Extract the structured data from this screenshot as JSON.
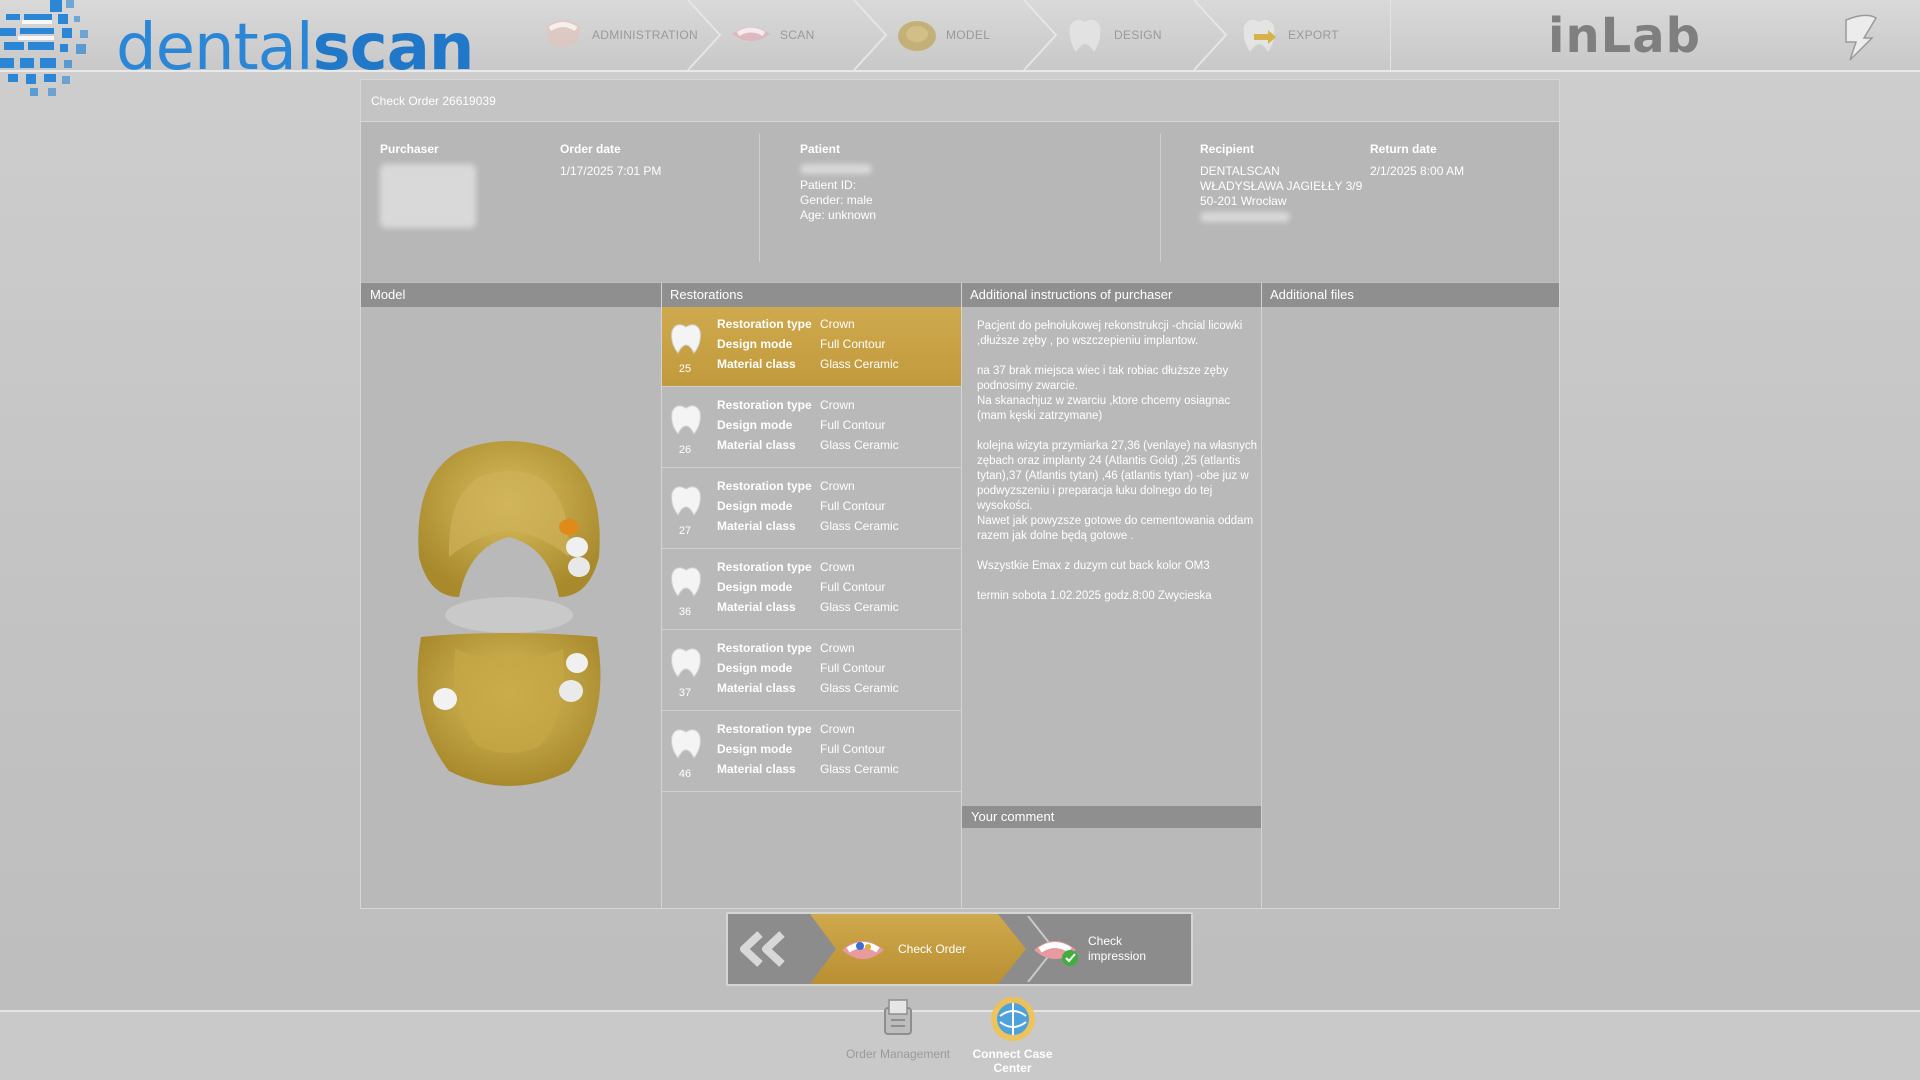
{
  "app": {
    "logo_prefix": "dental",
    "logo_suffix": "scan",
    "brand_right": "inLab"
  },
  "workflow": {
    "steps": [
      {
        "label": "ADMINISTRATION",
        "icon": "jaw-icon"
      },
      {
        "label": "SCAN",
        "icon": "scan-jaw-icon"
      },
      {
        "label": "MODEL",
        "icon": "model-icon"
      },
      {
        "label": "DESIGN",
        "icon": "design-tooth-icon"
      },
      {
        "label": "EXPORT",
        "icon": "export-tooth-icon"
      }
    ]
  },
  "order": {
    "title": "Check Order 26619039",
    "purchaser_label": "Purchaser",
    "order_date_label": "Order date",
    "order_date": "1/17/2025 7:01 PM",
    "patient_label": "Patient",
    "patient_id": "Patient ID:",
    "patient_gender": "Gender: male",
    "patient_age": "Age: unknown",
    "recipient_label": "Recipient",
    "recipient_line1": "DENTALSCAN",
    "recipient_line2": "WŁADYSŁAWA JAGIEŁŁY 3/9",
    "recipient_line3": "50-201 Wrocław",
    "return_date_label": "Return date",
    "return_date": "2/1/2025 8:00 AM"
  },
  "columns": {
    "model": "Model",
    "restorations": "Restorations",
    "instructions": "Additional instructions of purchaser",
    "files": "Additional files",
    "comment": "Your comment"
  },
  "restoration_keys": {
    "type": "Restoration type",
    "mode": "Design mode",
    "material": "Material class"
  },
  "restorations": [
    {
      "tooth": "25",
      "type": "Crown",
      "mode": "Full Contour",
      "material": "Glass Ceramic",
      "selected": true
    },
    {
      "tooth": "26",
      "type": "Crown",
      "mode": "Full Contour",
      "material": "Glass Ceramic",
      "selected": false
    },
    {
      "tooth": "27",
      "type": "Crown",
      "mode": "Full Contour",
      "material": "Glass Ceramic",
      "selected": false
    },
    {
      "tooth": "36",
      "type": "Crown",
      "mode": "Full Contour",
      "material": "Glass Ceramic",
      "selected": false
    },
    {
      "tooth": "37",
      "type": "Crown",
      "mode": "Full Contour",
      "material": "Glass Ceramic",
      "selected": false
    },
    {
      "tooth": "46",
      "type": "Crown",
      "mode": "Full Contour",
      "material": "Glass Ceramic",
      "selected": false
    }
  ],
  "instructions": [
    "Pacjent do pełnołukowej rekonstrukcji -chcial licowki ,dłuższe zęby , po wszczepieniu implantow.",
    "na 37 brak miejsca wiec i tak robiac dłuższe zęby podnosimy zwarcie.\nNa skanachjuz w zwarciu ,ktore chcemy osiagnac (mam kęski zatrzymane)",
    "kolejna wizyta przymiarka 27,36 (venlaye) na własnych zębach oraz implanty 24 (Atlantis Gold) ,25 (atlantis tytan),37 (Atlantis tytan) ,46 (atlantis tytan) -obe juz w podwyzszeniu i preparacja łuku dolnego do tej wysokości.\nNawet jak powyzsze gotowe do cementowania oddam razem jak dolne będą gotowe .",
    "Wszystkie Emax z duzym cut back kolor OM3",
    "termin sobota 1.02.2025 godz.8:00 Zwycieska"
  ],
  "wizard": {
    "current": "Check Order",
    "next_line1": "Check",
    "next_line2": "impression"
  },
  "dock": {
    "order_management": "Order Management",
    "connect_case_center": "Connect Case Center"
  },
  "colors": {
    "accent_gold": "#c9a145",
    "logo_blue": "#2178c8",
    "header_gray": "#8f8f8f"
  }
}
